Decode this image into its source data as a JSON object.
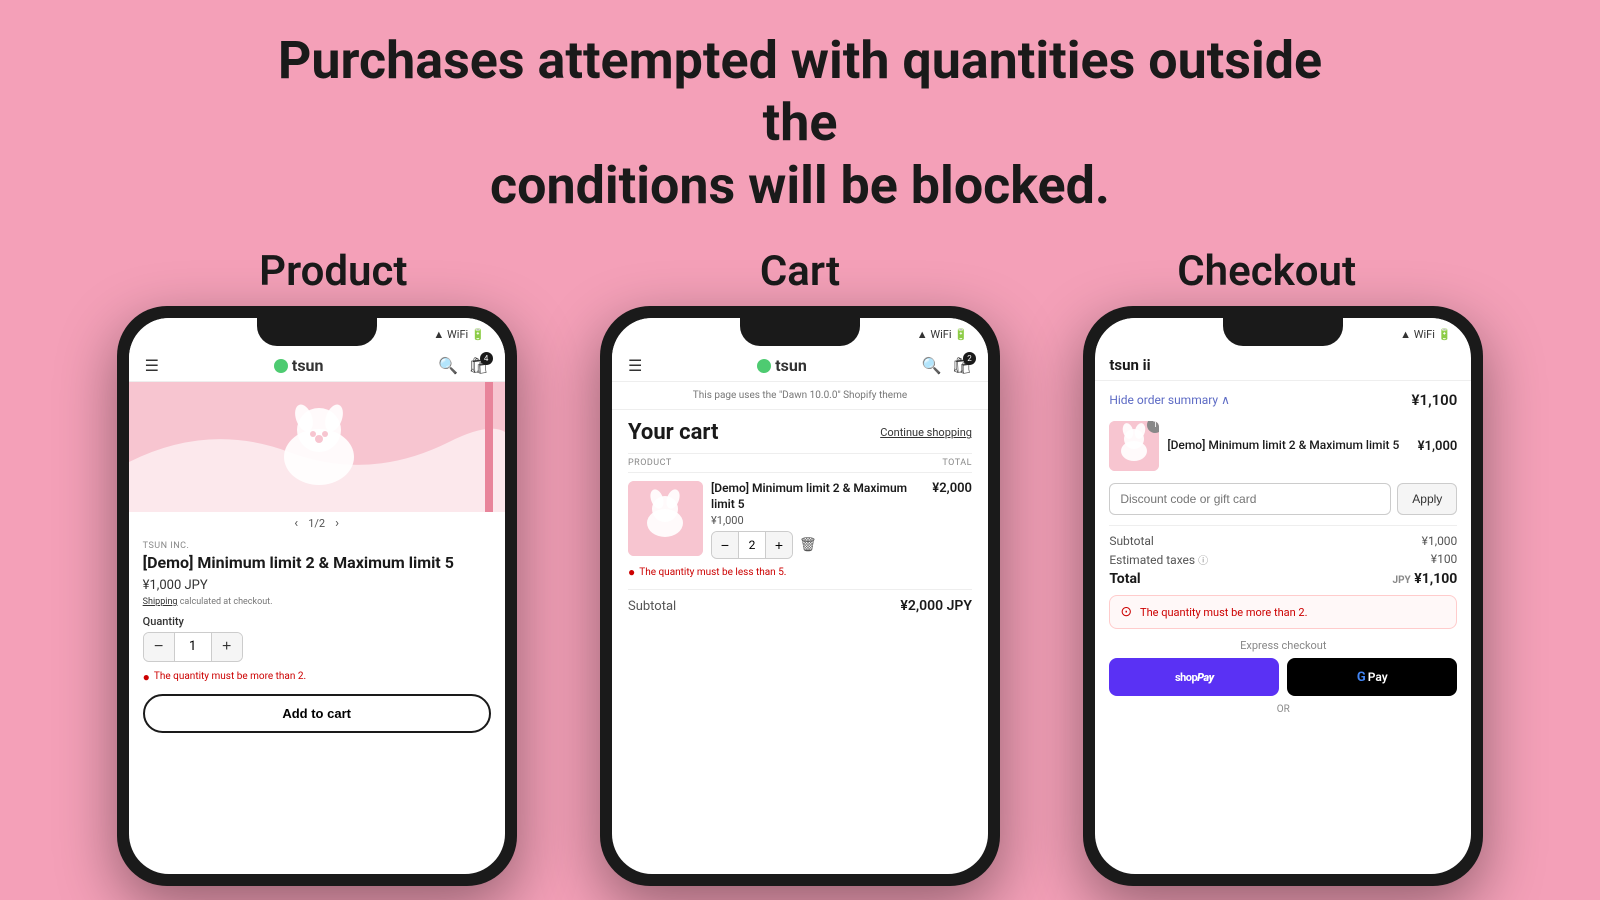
{
  "headline": {
    "line1": "Purchases attempted with quantities outside the",
    "line2": "conditions will be blocked."
  },
  "sections": {
    "product": {
      "label": "Product"
    },
    "cart": {
      "label": "Cart"
    },
    "checkout": {
      "label": "Checkout"
    }
  },
  "phone_product": {
    "store_name": "tsun",
    "image_counter": "1/2",
    "brand": "TSUN INC.",
    "product_name": "[Demo] Minimum limit 2 & Maximum limit 5",
    "price": "¥1,000 JPY",
    "shipping_label": "Shipping",
    "shipping_calc": "calculated at checkout.",
    "quantity_label": "Quantity",
    "qty_value": "1",
    "qty_minus": "−",
    "qty_plus": "+",
    "error": "The quantity must be more than 2.",
    "add_to_cart": "Add to cart",
    "cart_count": "4"
  },
  "phone_cart": {
    "store_name": "tsun",
    "theme_notice": "This page uses the \"Dawn 10.0.0\" Shopify theme",
    "cart_title": "Your cart",
    "continue_shopping": "Continue shopping",
    "col_product": "PRODUCT",
    "col_total": "TOTAL",
    "item_name": "[Demo] Minimum limit 2 & Maximum limit 5",
    "item_price": "¥1,000",
    "item_total": "¥2,000",
    "qty_value": "2",
    "qty_minus": "−",
    "qty_plus": "+",
    "error": "The quantity must be less than 5.",
    "subtotal_label": "Subtotal",
    "subtotal_value": "¥2,000 JPY",
    "cart_count": "2"
  },
  "phone_checkout": {
    "store_name": "tsun ii",
    "toggle_label": "Hide order summary",
    "toggle_amount": "¥1,100",
    "item_badge": "1",
    "item_name": "[Demo] Minimum limit 2 & Maximum limit 5",
    "item_price": "¥1,000",
    "discount_placeholder": "Discount code or gift card",
    "apply_btn": "Apply",
    "subtotal_label": "Subtotal",
    "subtotal_value": "¥1,000",
    "taxes_label": "Estimated taxes",
    "taxes_info": "ⓘ",
    "taxes_value": "¥100",
    "total_label": "Total",
    "total_currency": "JPY",
    "total_value": "¥1,100",
    "error": "The quantity must be more than 2.",
    "express_label": "Express checkout",
    "shop_pay": "shop Pay",
    "gpay": "G Pay",
    "or_label": "OR"
  },
  "icons": {
    "hamburger": "☰",
    "search": "🔍",
    "bag": "🛍",
    "chevron_left": "‹",
    "chevron_right": "›",
    "chevron_down": "∨",
    "trash": "🗑",
    "error_circle": "●"
  }
}
